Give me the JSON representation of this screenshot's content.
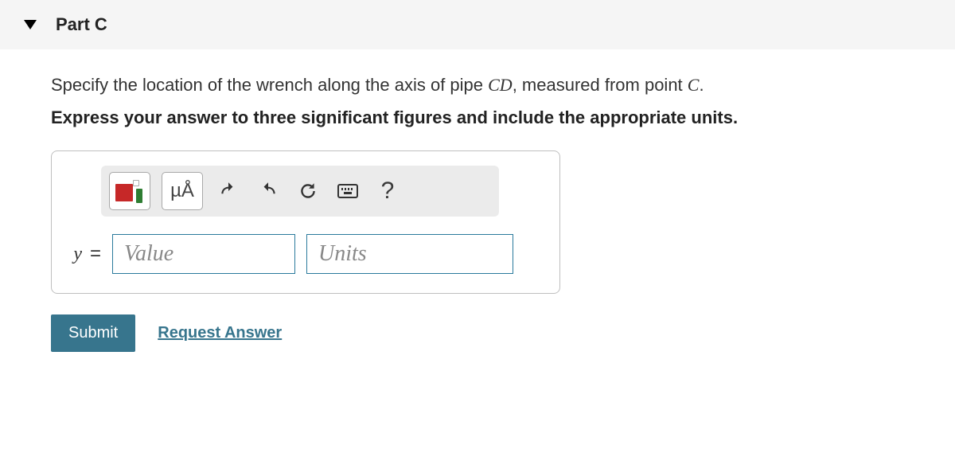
{
  "header": {
    "title": "Part C"
  },
  "question": {
    "line1_pre": "Specify the location of the wrench along the axis of pipe ",
    "line1_math1": "CD",
    "line1_mid": ", measured from point ",
    "line1_math2": "C",
    "line1_post": ".",
    "instruction": "Express your answer to three significant figures and include the appropriate units."
  },
  "toolbar": {
    "templates_label": "templates",
    "units_symbol": "µÅ",
    "undo_label": "undo",
    "redo_label": "redo",
    "reset_label": "reset",
    "keyboard_label": "keyboard",
    "help_label": "?"
  },
  "answer": {
    "variable": "y",
    "equals": "=",
    "value_placeholder": "Value",
    "units_placeholder": "Units"
  },
  "actions": {
    "submit_label": "Submit",
    "request_label": "Request Answer"
  }
}
